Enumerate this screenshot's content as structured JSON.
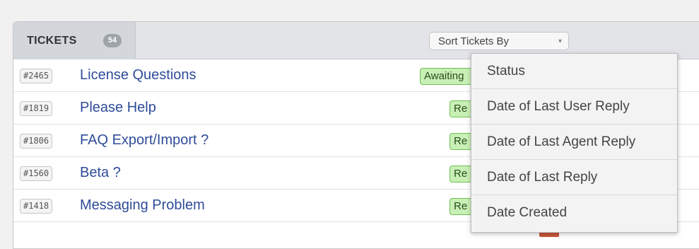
{
  "header": {
    "tab_title": "TICKETS",
    "tab_count": "54",
    "sort_label": "Sort Tickets By",
    "sort_arrow": "▾"
  },
  "tickets": [
    {
      "id": "#2465",
      "title": "License Questions",
      "status": "Awaiting"
    },
    {
      "id": "#1819",
      "title": "Please Help",
      "status": "Re"
    },
    {
      "id": "#1806",
      "title": "FAQ Export/Import ?",
      "status": "Re"
    },
    {
      "id": "#1560",
      "title": "Beta ?",
      "status": "Re"
    },
    {
      "id": "#1418",
      "title": "Messaging Problem",
      "status": "Re"
    }
  ],
  "sort_menu": {
    "items": [
      "Status",
      "Date of Last User Reply",
      "Date of Last Agent Reply",
      "Date of Last Reply",
      "Date Created"
    ]
  },
  "colors": {
    "link": "#2f4c99",
    "status_bg": "#c8f0b5",
    "status_border": "#6fbf52",
    "count_badge": "#9fa4ab"
  }
}
